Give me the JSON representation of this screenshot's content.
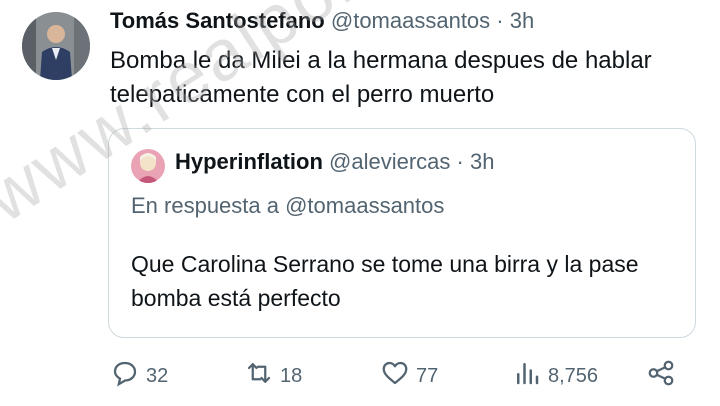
{
  "tweet": {
    "author": {
      "display_name": "Tomás Santostefano",
      "handle": "@tomaassantos",
      "time": "3h",
      "separator": "·"
    },
    "text": "Bomba le da Milei a la hermana despues de hablar telepaticamente con el perro muerto",
    "quote": {
      "author": {
        "display_name": "Hyperinflation",
        "handle": "@aleviercas",
        "time": "3h",
        "separator": "·"
      },
      "reply_to": "En respuesta a @tomaassantos",
      "text": "Que Carolina Serrano se tome una birra y la pase bomba está perfecto"
    },
    "actions": {
      "replies": "32",
      "reposts": "18",
      "likes": "77",
      "views": "8,756"
    }
  },
  "watermark": "www.realpolitik.com.ar",
  "colors": {
    "text_primary": "#0f1419",
    "text_secondary": "#536471",
    "border": "#cfd9de"
  },
  "icons": [
    "reply-icon",
    "repost-icon",
    "like-icon",
    "views-icon",
    "share-icon"
  ]
}
